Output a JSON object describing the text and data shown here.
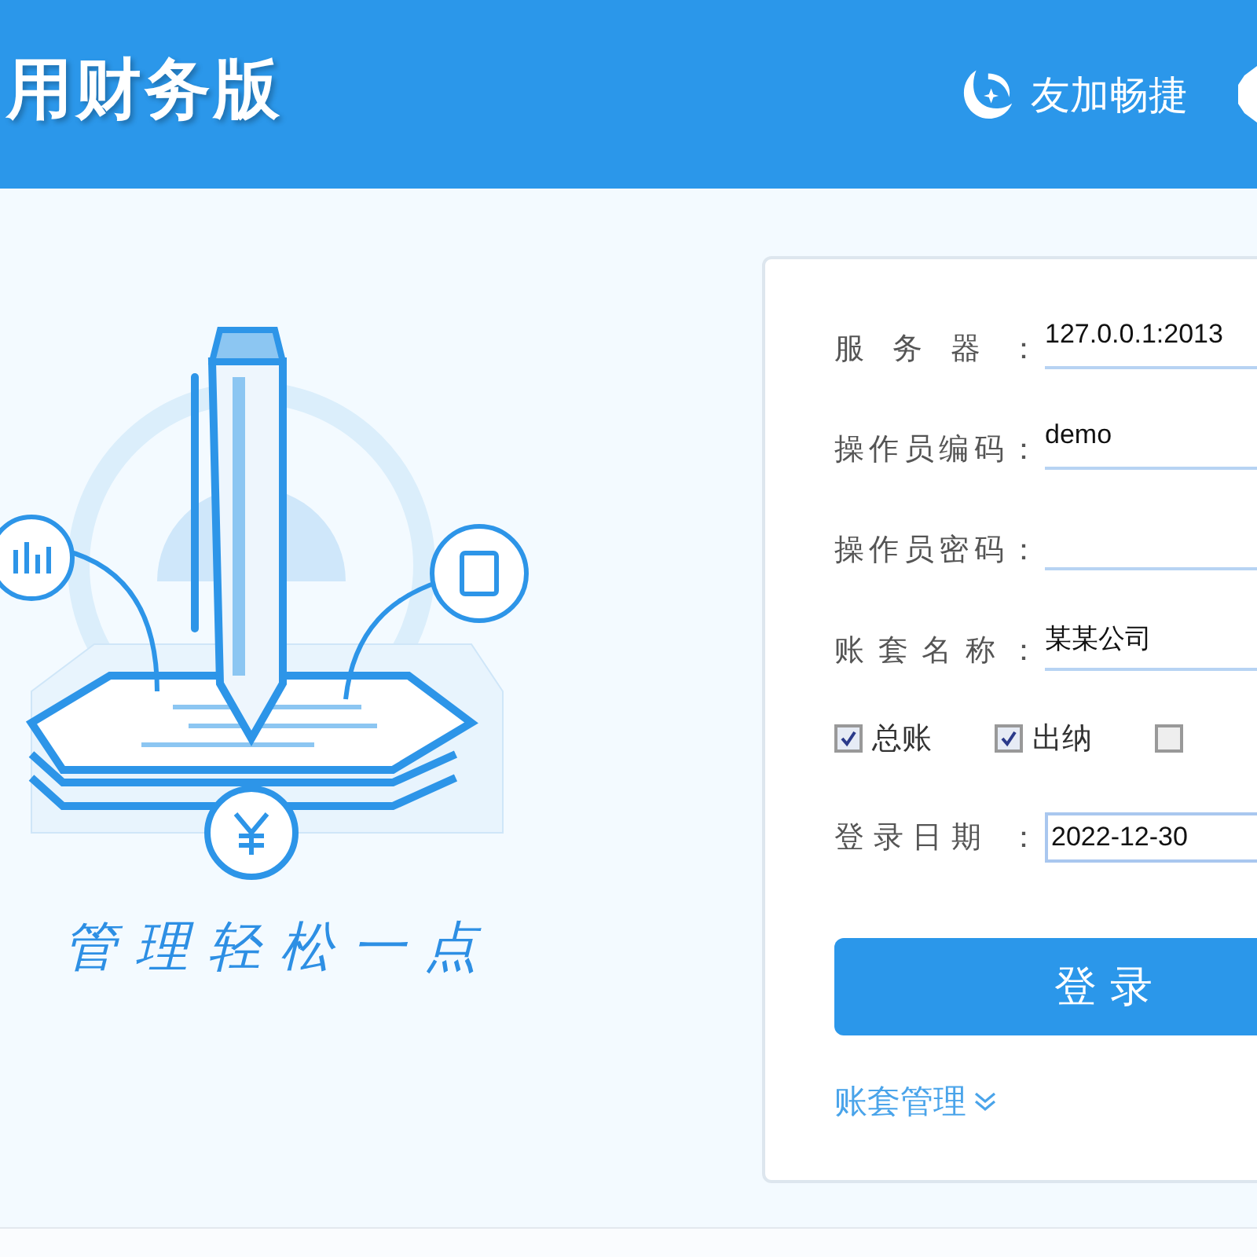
{
  "header": {
    "title": "用财务版",
    "brand": "友加畅捷"
  },
  "slogan": "管理轻松一点",
  "form": {
    "fields": [
      {
        "label": "服务器：",
        "value": "127.0.0.1:2013",
        "kind": "line"
      },
      {
        "label": "操作员编码：",
        "value": "demo",
        "kind": "line"
      },
      {
        "label": "操作员密码：",
        "kind": "line"
      },
      {
        "label": "账套名称：",
        "value": "某某公司",
        "kind": "line"
      }
    ],
    "modules": [
      {
        "label": "总账",
        "checked": true
      },
      {
        "label": "出纳",
        "checked": true
      },
      {
        "checked": false
      }
    ],
    "date": {
      "label": "登录日期 ：",
      "value": "2022-12-30"
    },
    "login_button": "登 录",
    "manage_link": "账套管理"
  }
}
